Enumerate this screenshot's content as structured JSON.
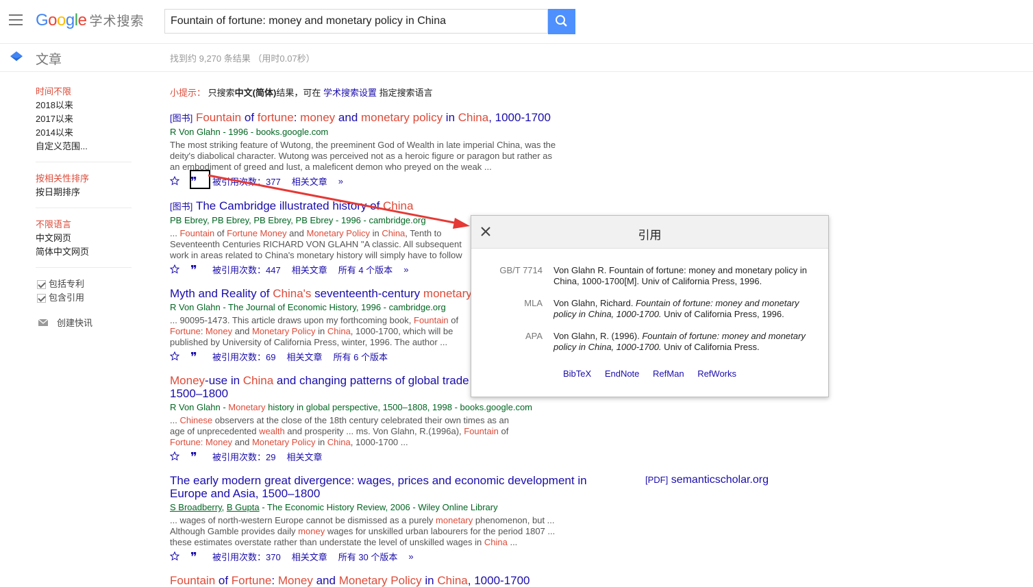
{
  "header": {
    "logo_google": [
      "G",
      "o",
      "o",
      "g",
      "l",
      "e"
    ],
    "logo_suffix": "学术搜索",
    "search_value": "Fountain of fortune: money and monetary policy in China"
  },
  "subheader": {
    "section_label": "文章",
    "stats": "找到约 9,270 条结果 （用时0.07秒）"
  },
  "sidebar": {
    "time": [
      "时间不限",
      "2018以来",
      "2017以来",
      "2014以来",
      "自定义范围..."
    ],
    "sort": [
      "按相关性排序",
      "按日期排序"
    ],
    "lang": [
      "不限语言",
      "中文网页",
      "简体中文网页"
    ],
    "checks": [
      "包括专利",
      "包含引用"
    ],
    "alert": "创建快讯"
  },
  "tip": {
    "label": "小提示：",
    "pre": "只搜索",
    "bold": "中文(简体)",
    "mid": "结果，可在",
    "link": "学术搜索设置",
    "post": "指定搜索语言"
  },
  "results": [
    {
      "tag": "[图书]",
      "authors": "R Von Glahn - 1996 - books.google.com",
      "snippet": "The most striking feature of Wutong, the preeminent God of Wealth in late imperial China, was the deity's diabolical character. Wutong was perceived not as a heroic figure or paragon but rather as an embodiment of greed and lust, a maleficent demon who preyed on the weak ...",
      "cited": "被引用次数：377",
      "related": "相关文章",
      "versions": ""
    },
    {
      "tag": "[图书]",
      "authors": "PB Ebrey, PB Ebrey, PB Ebrey, PB Ebrey - 1996 - cambridge.org",
      "cited": "被引用次数：447",
      "related": "相关文章",
      "versions": "所有 4 个版本"
    },
    {
      "authors": "R Von Glahn - The Journal of Economic History, 1996 - cambridge.org",
      "cited": "被引用次数：69",
      "related": "相关文章",
      "versions": "所有 6 个版本"
    },
    {
      "authors_pre": "R Von Glahn - ",
      "authors_hl": "Monetary",
      "authors_post": " history in global perspective, 1500–1808, 1998 - books.google.com",
      "cited": "被引用次数：29",
      "related": "相关文章",
      "versions": ""
    },
    {
      "title": "The early modern great divergence: wages, prices and economic development in Europe and Asia, 1500–1800",
      "author1": "S Broadberry",
      "author2": "B Gupta",
      "source": " - The Economic History Review, 2006 - Wiley Online Library",
      "cited": "被引用次数：370",
      "related": "相关文章",
      "versions": "所有 30 个版本"
    }
  ],
  "pdf": {
    "tag": "[PDF]",
    "site": "semanticscholar.org"
  },
  "popup": {
    "title": "引用",
    "citations": [
      {
        "style": "GB/T 7714",
        "text": "Von Glahn R. Fountain of fortune: money and monetary policy in China, 1000-1700[M]. Univ of California Press, 1996."
      },
      {
        "style": "MLA",
        "pre": "Von Glahn, Richard. ",
        "italic": "Fountain of fortune: money and monetary policy in China, 1000-1700.",
        "post": " Univ of California Press, 1996."
      },
      {
        "style": "APA",
        "pre": "Von Glahn, R. (1996). ",
        "italic": "Fountain of fortune: money and monetary policy in China, 1000-1700.",
        "post": " Univ of California Press."
      }
    ],
    "exports": [
      "BibTeX",
      "EndNote",
      "RefMan",
      "RefWorks"
    ]
  },
  "colors": {
    "accent": "#4d90fe",
    "link": "#1a0dab",
    "author_green": "#006621",
    "highlight": "#dd4b39",
    "arrow": "#e53935"
  }
}
